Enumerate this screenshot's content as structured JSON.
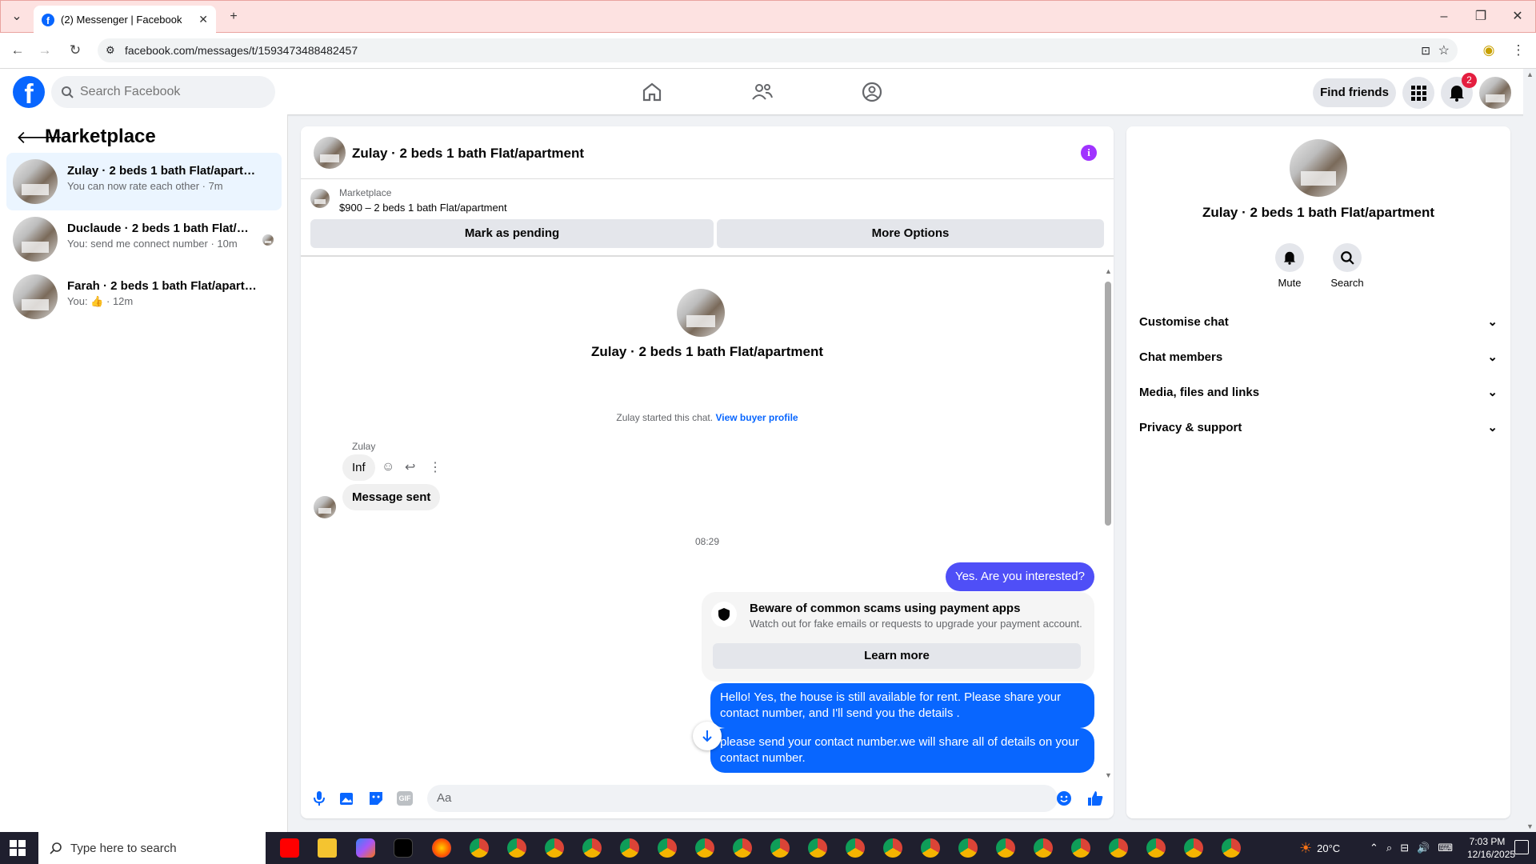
{
  "browser": {
    "tab_title": "(2) Messenger | Facebook",
    "url": "facebook.com/messages/t/1593473488482457"
  },
  "fb": {
    "search_placeholder": "Search Facebook",
    "find_friends": "Find friends",
    "notif_count": "2"
  },
  "left": {
    "title": "Marketplace",
    "conversations": [
      {
        "name": "Zulay · 2 beds 1 bath Flat/apartment",
        "sub": "You can now rate each other · 7m"
      },
      {
        "name": "Duclaude · 2 beds 1 bath Flat/ap...",
        "sub": "You: send me connect number · 10m"
      },
      {
        "name": "Farah · 2 beds 1 bath Flat/apartment",
        "sub_prefix": "You:",
        "sub_suffix": "· 12m"
      }
    ]
  },
  "chat": {
    "title": "Zulay · 2 beds 1 bath Flat/apartment",
    "marketplace_label": "Marketplace",
    "listing": "$900 – 2 beds 1 bath Flat/apartment",
    "mark_pending": "Mark as pending",
    "more_options": "More Options",
    "center_name": "Zulay · 2 beds 1 bath Flat/apartment",
    "started_text": "Zulay started this chat.",
    "view_profile": "View buyer profile",
    "sender": "Zulay",
    "msg_inf": "Inf",
    "msg_sent": "Message sent",
    "time": "08:29",
    "msg_interested": "Yes. Are you interested?",
    "scam_title": "Beware of common scams using payment apps",
    "scam_desc": "Watch out for fake emails or requests to upgrade your payment account.",
    "learn_more": "Learn more",
    "msg_hello": "Hello! Yes, the house is still available for rent. Please share your contact number, and I'll send you the details .",
    "msg_please": "please send your contact number.we will share all of details on your contact number.",
    "composer_placeholder": "Aa"
  },
  "right": {
    "name": "Zulay · 2 beds 1 bath Flat/apartment",
    "mute": "Mute",
    "search": "Search",
    "sections": [
      "Customise chat",
      "Chat members",
      "Media, files and links",
      "Privacy & support"
    ]
  },
  "taskbar": {
    "search_placeholder": "Type here to search",
    "temp": "20°C",
    "time": "7:03 PM",
    "date": "12/16/2025"
  }
}
